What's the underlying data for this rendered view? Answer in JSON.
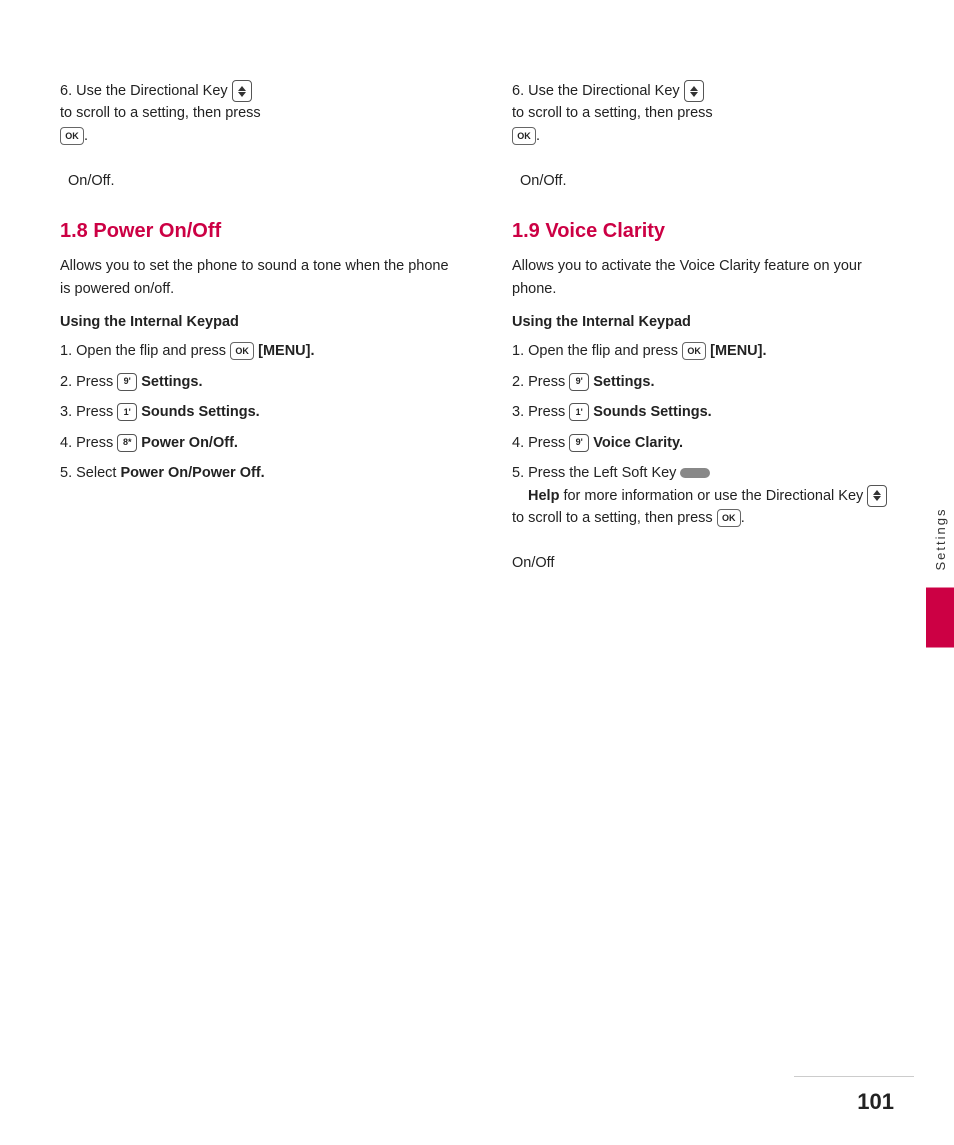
{
  "page": {
    "number": "101",
    "side_tab_label": "Settings"
  },
  "left_col": {
    "intro": {
      "step6_text": "6. Use the Directional Key",
      "step6_detail": "to scroll to a setting, then press",
      "ok_label": "OK",
      "on_off": "On/Off."
    },
    "section": {
      "heading": "1.8 Power On/Off",
      "body": "Allows you to set the phone to sound a tone when the phone is powered on/off.",
      "subsection_heading": "Using the Internal Keypad",
      "steps": [
        {
          "num": "1.",
          "text": "Open the flip and press",
          "btn": "OK",
          "bold": "[MENU]."
        },
        {
          "num": "2.",
          "text": "Press",
          "btn": "9",
          "bold": "Settings."
        },
        {
          "num": "3.",
          "text": "Press",
          "btn": "1",
          "bold": "Sounds Settings."
        },
        {
          "num": "4.",
          "text": "Press",
          "btn": "8",
          "bold": "Power On/Off."
        },
        {
          "num": "5.",
          "text": "Select",
          "bold": "Power On/Power Off."
        }
      ]
    }
  },
  "right_col": {
    "intro": {
      "step6_text": "6. Use the Directional Key",
      "step6_detail": "to scroll to a setting, then press",
      "ok_label": "OK",
      "on_off": "On/Off."
    },
    "section": {
      "heading": "1.9 Voice Clarity",
      "body": "Allows you to activate the Voice Clarity feature on your phone.",
      "subsection_heading": "Using the Internal Keypad",
      "steps": [
        {
          "num": "1.",
          "text": "Open the flip and press",
          "btn": "OK",
          "bold": "[MENU]."
        },
        {
          "num": "2.",
          "text": "Press",
          "btn": "9",
          "bold": "Settings."
        },
        {
          "num": "3.",
          "text": "Press",
          "btn": "1",
          "bold": "Sounds Settings."
        },
        {
          "num": "4.",
          "text": "Press",
          "btn": "9",
          "bold": "Voice Clarity."
        },
        {
          "num": "5.",
          "text_before": "Press the Left Soft Key",
          "bold_mid": "Help",
          "text_mid": "for more information or use the Directional Key",
          "text_after": "to scroll to a setting, then press",
          "on_off_after": "On/Off"
        }
      ]
    }
  }
}
